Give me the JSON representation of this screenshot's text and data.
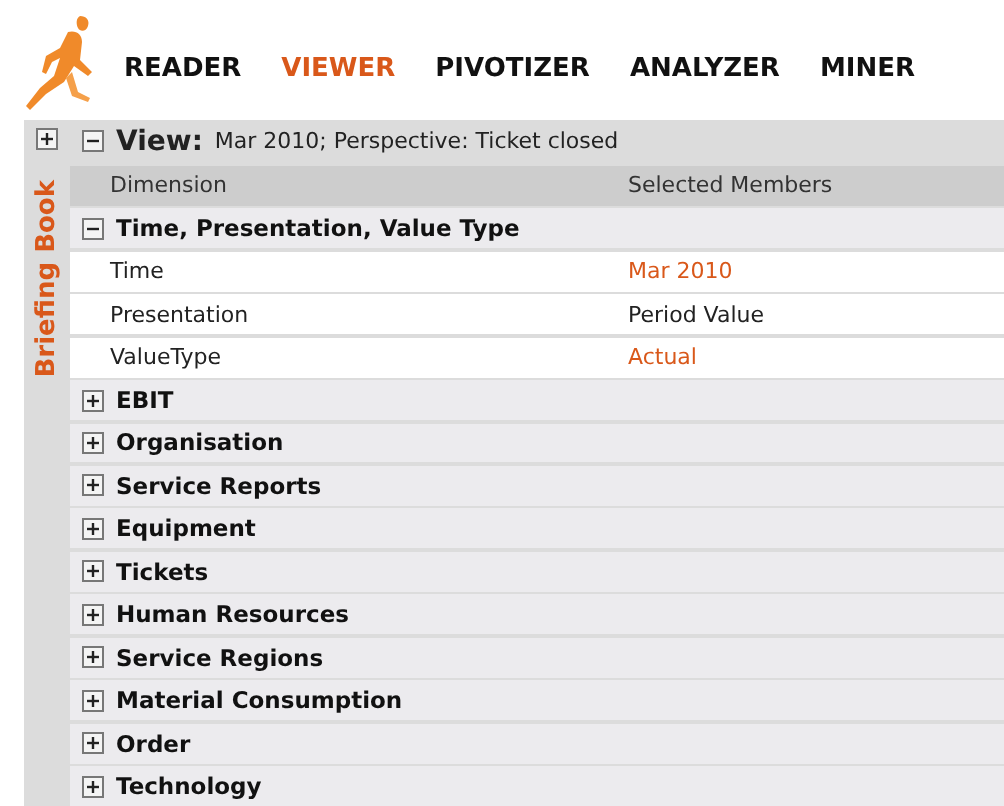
{
  "nav": [
    {
      "label": "READER",
      "selected": false
    },
    {
      "label": "VIEWER",
      "selected": true
    },
    {
      "label": "PIVOTIZER",
      "selected": false
    },
    {
      "label": "ANALYZER",
      "selected": false
    },
    {
      "label": "MINER",
      "selected": false
    }
  ],
  "sidebar": {
    "label": "Briefing Book",
    "expanded": false
  },
  "view": {
    "label": "View:",
    "text": "Mar 2010; Perspective: Ticket closed",
    "expanded": true
  },
  "table": {
    "columns": [
      "Dimension",
      "Selected Members"
    ],
    "groups": [
      {
        "label": "Time, Presentation, Value Type",
        "expanded": true,
        "members": [
          {
            "dimension": "Time",
            "value": "Mar 2010",
            "highlighted": true
          },
          {
            "dimension": "Presentation",
            "value": "Period Value",
            "highlighted": false
          },
          {
            "dimension": "ValueType",
            "value": "Actual",
            "highlighted": true
          }
        ]
      },
      {
        "label": "EBIT",
        "expanded": false
      },
      {
        "label": "Organisation",
        "expanded": false
      },
      {
        "label": "Service Reports",
        "expanded": false
      },
      {
        "label": "Equipment",
        "expanded": false
      },
      {
        "label": "Tickets",
        "expanded": false
      },
      {
        "label": "Human Resources",
        "expanded": false
      },
      {
        "label": "Service Regions",
        "expanded": false
      },
      {
        "label": "Material Consumption",
        "expanded": false
      },
      {
        "label": "Order",
        "expanded": false
      },
      {
        "label": "Technology",
        "expanded": false
      }
    ]
  }
}
